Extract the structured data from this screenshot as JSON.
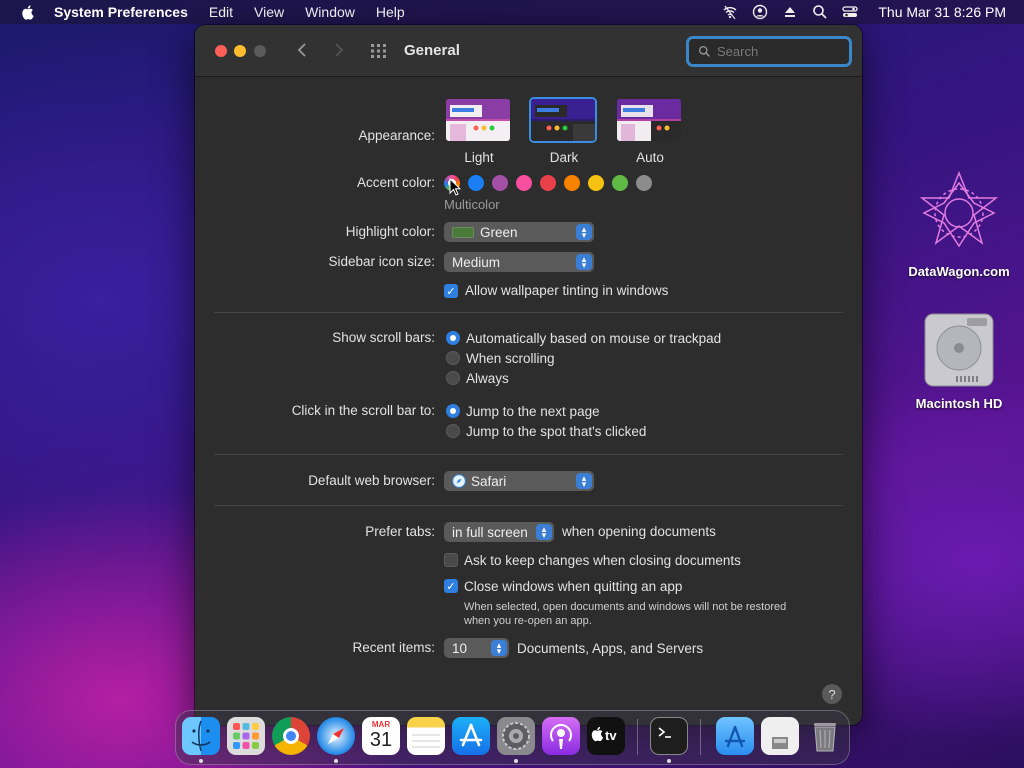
{
  "menubar": {
    "app_name": "System Preferences",
    "menus": [
      "Edit",
      "View",
      "Window",
      "Help"
    ],
    "clock": "Thu Mar 31  8:26 PM"
  },
  "window": {
    "title": "General",
    "search_placeholder": "Search"
  },
  "general": {
    "appearance": {
      "label": "Appearance:",
      "options": [
        "Light",
        "Dark",
        "Auto"
      ],
      "selected": "Dark"
    },
    "accent": {
      "label": "Accent color:",
      "selected_name": "Multicolor",
      "colors": [
        "multicolor",
        "#1a7ff5",
        "#a550a7",
        "#f74f9e",
        "#e8414a",
        "#f78200",
        "#f5c211",
        "#62ba46",
        "#8c8c8c"
      ]
    },
    "highlight": {
      "label": "Highlight color:",
      "value": "Green"
    },
    "sidebar_icon": {
      "label": "Sidebar icon size:",
      "value": "Medium"
    },
    "wallpaper_tint": {
      "label": "Allow wallpaper tinting in windows",
      "checked": true
    },
    "scroll_bars": {
      "label": "Show scroll bars:",
      "options": [
        "Automatically based on mouse or trackpad",
        "When scrolling",
        "Always"
      ],
      "selected": 0
    },
    "click_scroll": {
      "label": "Click in the scroll bar to:",
      "options": [
        "Jump to the next page",
        "Jump to the spot that's clicked"
      ],
      "selected": 0
    },
    "browser": {
      "label": "Default web browser:",
      "value": "Safari"
    },
    "prefer_tabs": {
      "label": "Prefer tabs:",
      "value": "in full screen",
      "suffix": "when opening documents"
    },
    "ask_keep": {
      "label": "Ask to keep changes when closing documents",
      "checked": false
    },
    "close_windows": {
      "label": "Close windows when quitting an app",
      "checked": true,
      "note_line1": "When selected, open documents and windows will not be restored",
      "note_line2": "when you re-open an app."
    },
    "recent": {
      "label": "Recent items:",
      "value": "10",
      "suffix": "Documents, Apps, and Servers"
    },
    "help": "?"
  },
  "desktop": {
    "icons": [
      {
        "label": "DataWagon.com"
      },
      {
        "label": "Macintosh HD"
      }
    ]
  },
  "dock": {
    "items": [
      "Finder",
      "Launchpad",
      "Chrome",
      "Safari",
      "Calendar",
      "Notes",
      "App Store",
      "System Preferences",
      "Podcasts",
      "TV",
      "Terminal",
      "Applications",
      "File",
      "Trash"
    ],
    "calendar_month": "MAR",
    "calendar_day": "31",
    "tv_label": "tv"
  }
}
